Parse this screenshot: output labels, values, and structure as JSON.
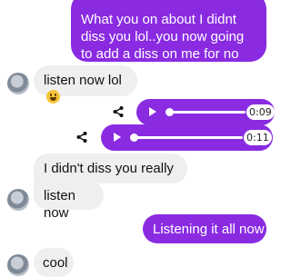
{
  "messages": {
    "m1": "What you on about I didnt diss you lol..you now going to add a diss on me for no reason lol",
    "m2": "listen now lol",
    "m3": "I didn't diss you really",
    "m4": "listen now",
    "m5": "Listening it all now",
    "m6": "cool"
  },
  "audio": [
    {
      "duration": "0:09",
      "progress": 0.0
    },
    {
      "duration": "0:11",
      "progress": 0.0
    }
  ],
  "icons": {
    "share": "share-icon",
    "play": "play-icon",
    "emoji": "grinning-face-emoji"
  },
  "colors": {
    "outgoing": "#8a2be2",
    "incoming": "#efefef"
  }
}
